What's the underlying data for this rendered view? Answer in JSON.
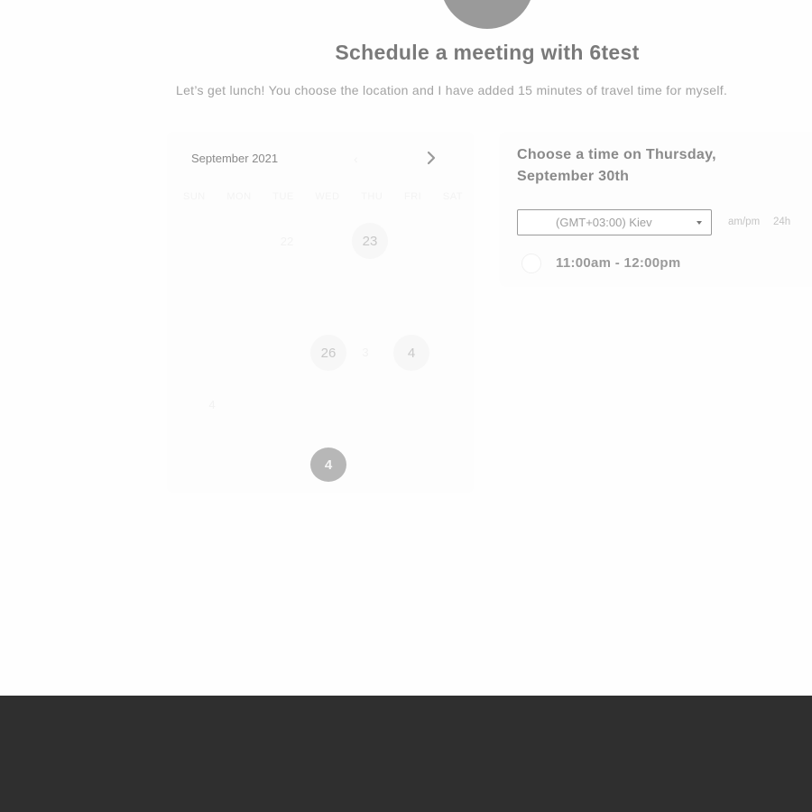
{
  "header": {
    "title": "Schedule a meeting with 6test",
    "subtitle": "Let’s get lunch! You choose the location and I have added 15 minutes of travel time for myself."
  },
  "calendar": {
    "month_label": "September 2021",
    "prev_icon": "chevron-left-icon",
    "next_icon": "chevron-right-icon",
    "weekdays": [
      "SUN",
      "MON",
      "TUE",
      "WED",
      "THU",
      "FRI",
      "SAT"
    ],
    "days": {
      "d22": "22",
      "d23": "23",
      "d26": "26",
      "d3": "3",
      "d4a": "4",
      "d4b": "4",
      "d4sel": "4"
    }
  },
  "time_panel": {
    "heading": "Choose a time on Thursday, September 30th",
    "timezone_value": "(GMT+03:00) Kiev",
    "format_ampm": "am/pm",
    "format_24h": "24h",
    "slot_label": "11:00am - 12:00pm"
  },
  "colors": {
    "footer": "#2f2f2f",
    "selected_day": "#b7b7b7",
    "avatar": "#9a9a9a"
  }
}
